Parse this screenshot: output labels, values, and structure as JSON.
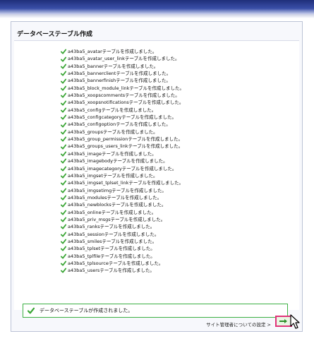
{
  "panel": {
    "title": "データベーステーブル作成"
  },
  "table_messages": [
    "a43ba5_avatarテーブルを作成しました。",
    "a43ba5_avatar_user_linkテーブルを作成しました。",
    "a43ba5_bannerテーブルを作成しました。",
    "a43ba5_bannerclientテーブルを作成しました。",
    "a43ba5_bannerfinishテーブルを作成しました。",
    "a43ba5_block_module_linkテーブルを作成しました。",
    "a43ba5_xoopscommentsテーブルを作成しました。",
    "a43ba5_xoopsnotificationsテーブルを作成しました。",
    "a43ba5_configテーブルを作成しました。",
    "a43ba5_configcategoryテーブルを作成しました。",
    "a43ba5_configoptionテーブルを作成しました。",
    "a43ba5_groupsテーブルを作成しました。",
    "a43ba5_group_permissionテーブルを作成しました。",
    "a43ba5_groups_users_linkテーブルを作成しました。",
    "a43ba5_imageテーブルを作成しました。",
    "a43ba5_imagebodyテーブルを作成しました。",
    "a43ba5_imagecategoryテーブルを作成しました。",
    "a43ba5_imgsetテーブルを作成しました。",
    "a43ba5_imgset_tplset_linkテーブルを作成しました。",
    "a43ba5_imgsetimgテーブルを作成しました。",
    "a43ba5_modulesテーブルを作成しました。",
    "a43ba5_newblocksテーブルを作成しました。",
    "a43ba5_onlineテーブルを作成しました。",
    "a43ba5_priv_msgsテーブルを作成しました。",
    "a43ba5_ranksテーブルを作成しました。",
    "a43ba5_sessionテーブルを作成しました。",
    "a43ba5_smilesテーブルを作成しました。",
    "a43ba5_tplsetテーブルを作成しました。",
    "a43ba5_tplfileテーブルを作成しました。",
    "a43ba5_tplsourceテーブルを作成しました。",
    "a43ba5_usersテーブルを作成しました。"
  ],
  "result": {
    "message": "データベーステーブルが作成されました。"
  },
  "footer": {
    "next_label": "サイト管理者についての設定 >"
  },
  "icons": {
    "check": "check-icon",
    "next": "arrow-right-icon",
    "cursor": "mouse-pointer-icon"
  },
  "colors": {
    "check_green": "#3aa535",
    "result_border": "#3cb043",
    "next_button_border": "#e0337a",
    "header_blue": "#1f2f7a"
  }
}
